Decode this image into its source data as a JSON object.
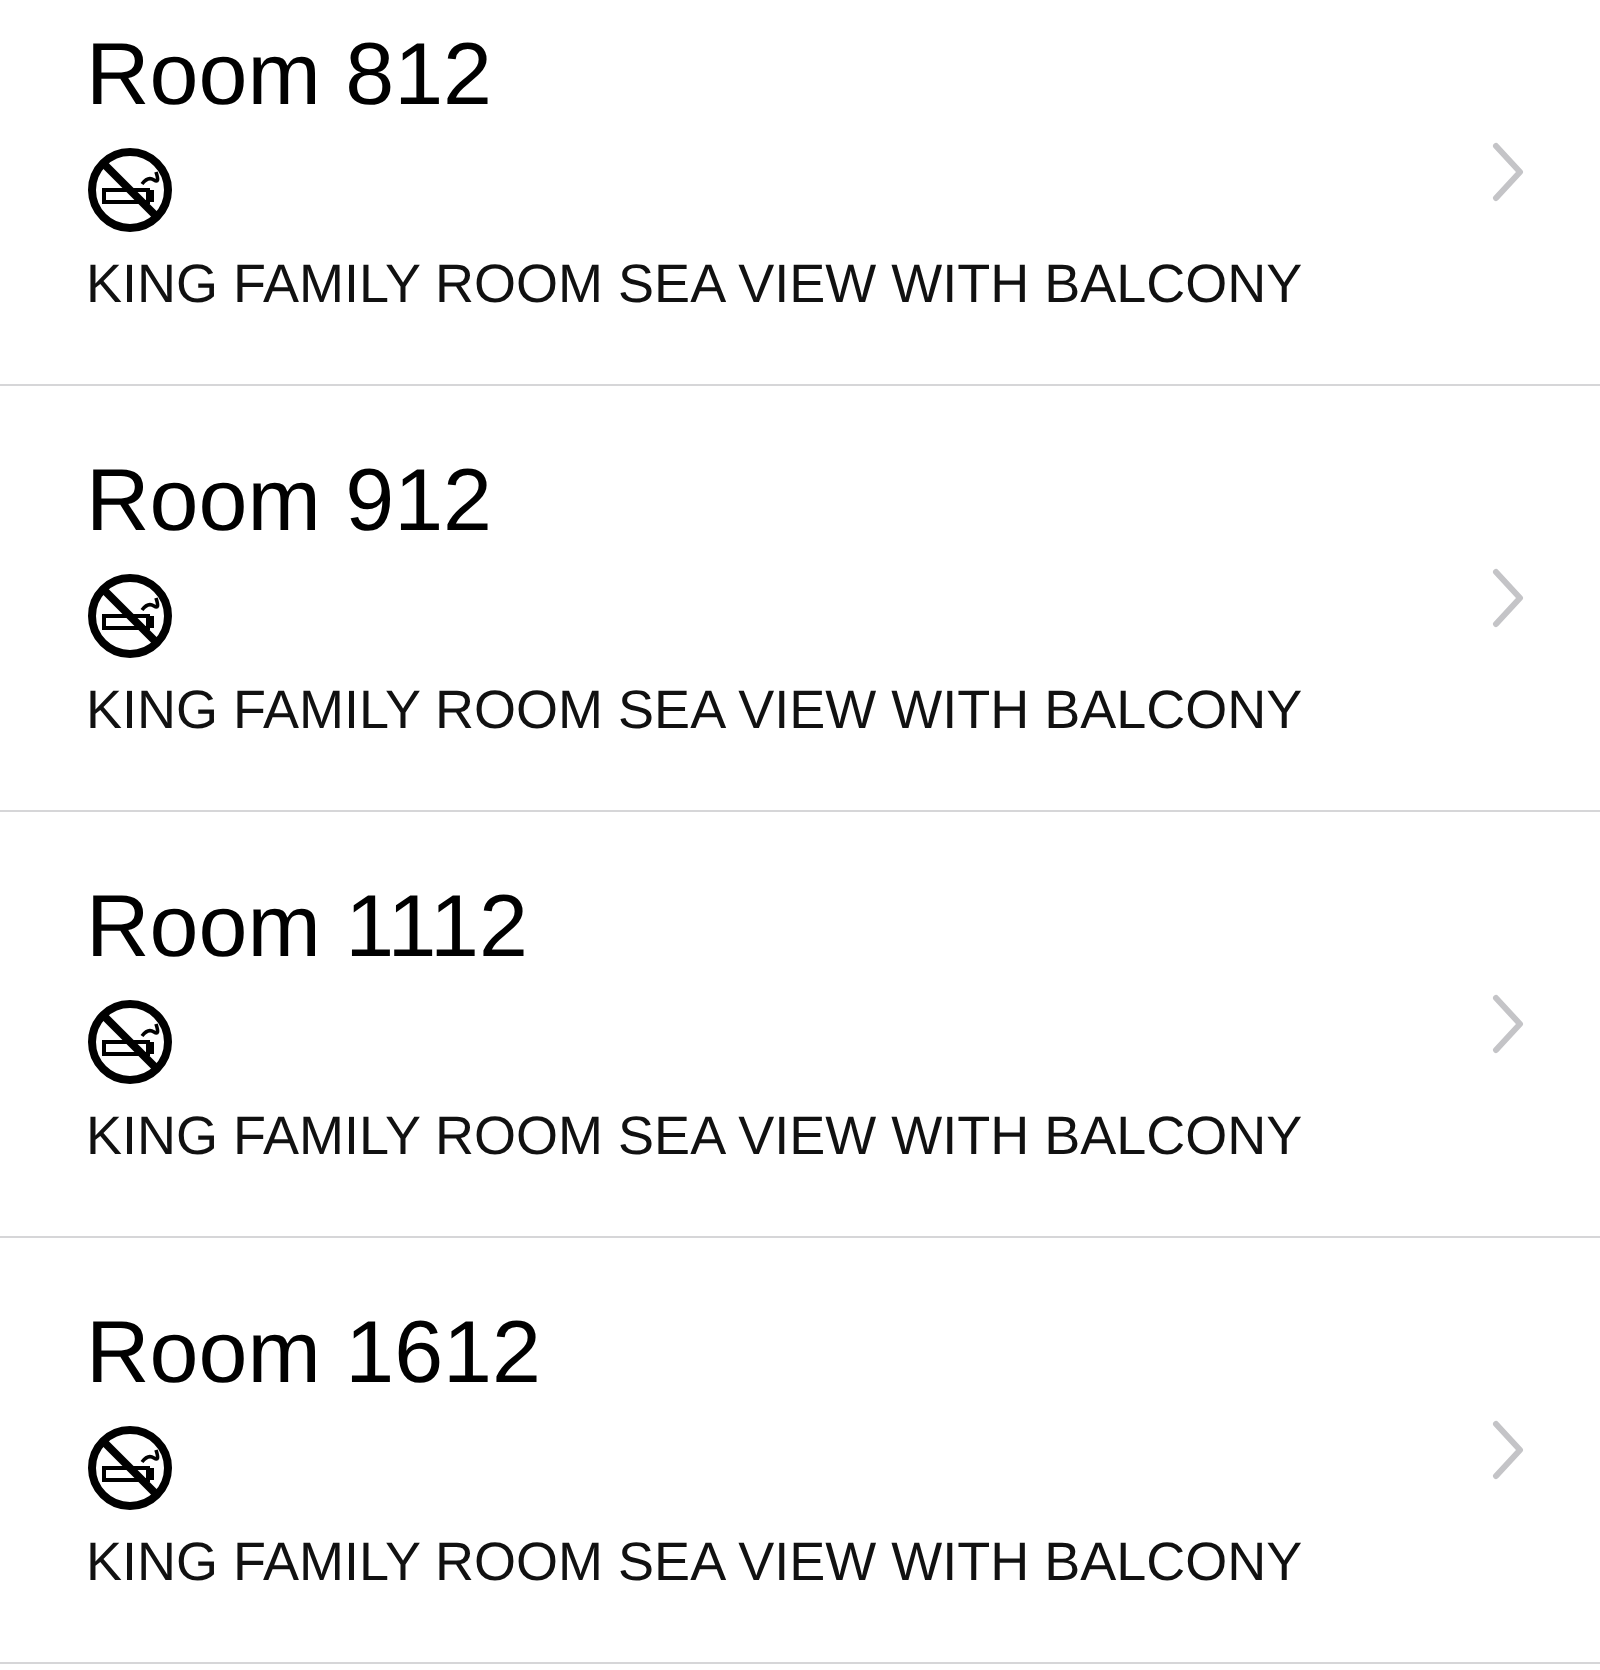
{
  "rooms": [
    {
      "title": "Room 812",
      "description": "KING FAMILY ROOM SEA VIEW WITH BALCONY"
    },
    {
      "title": "Room 912",
      "description": "KING FAMILY ROOM SEA VIEW WITH BALCONY"
    },
    {
      "title": "Room 1112",
      "description": "KING FAMILY ROOM SEA VIEW WITH BALCONY"
    },
    {
      "title": "Room 1612",
      "description": "KING FAMILY ROOM SEA VIEW WITH BALCONY"
    }
  ]
}
